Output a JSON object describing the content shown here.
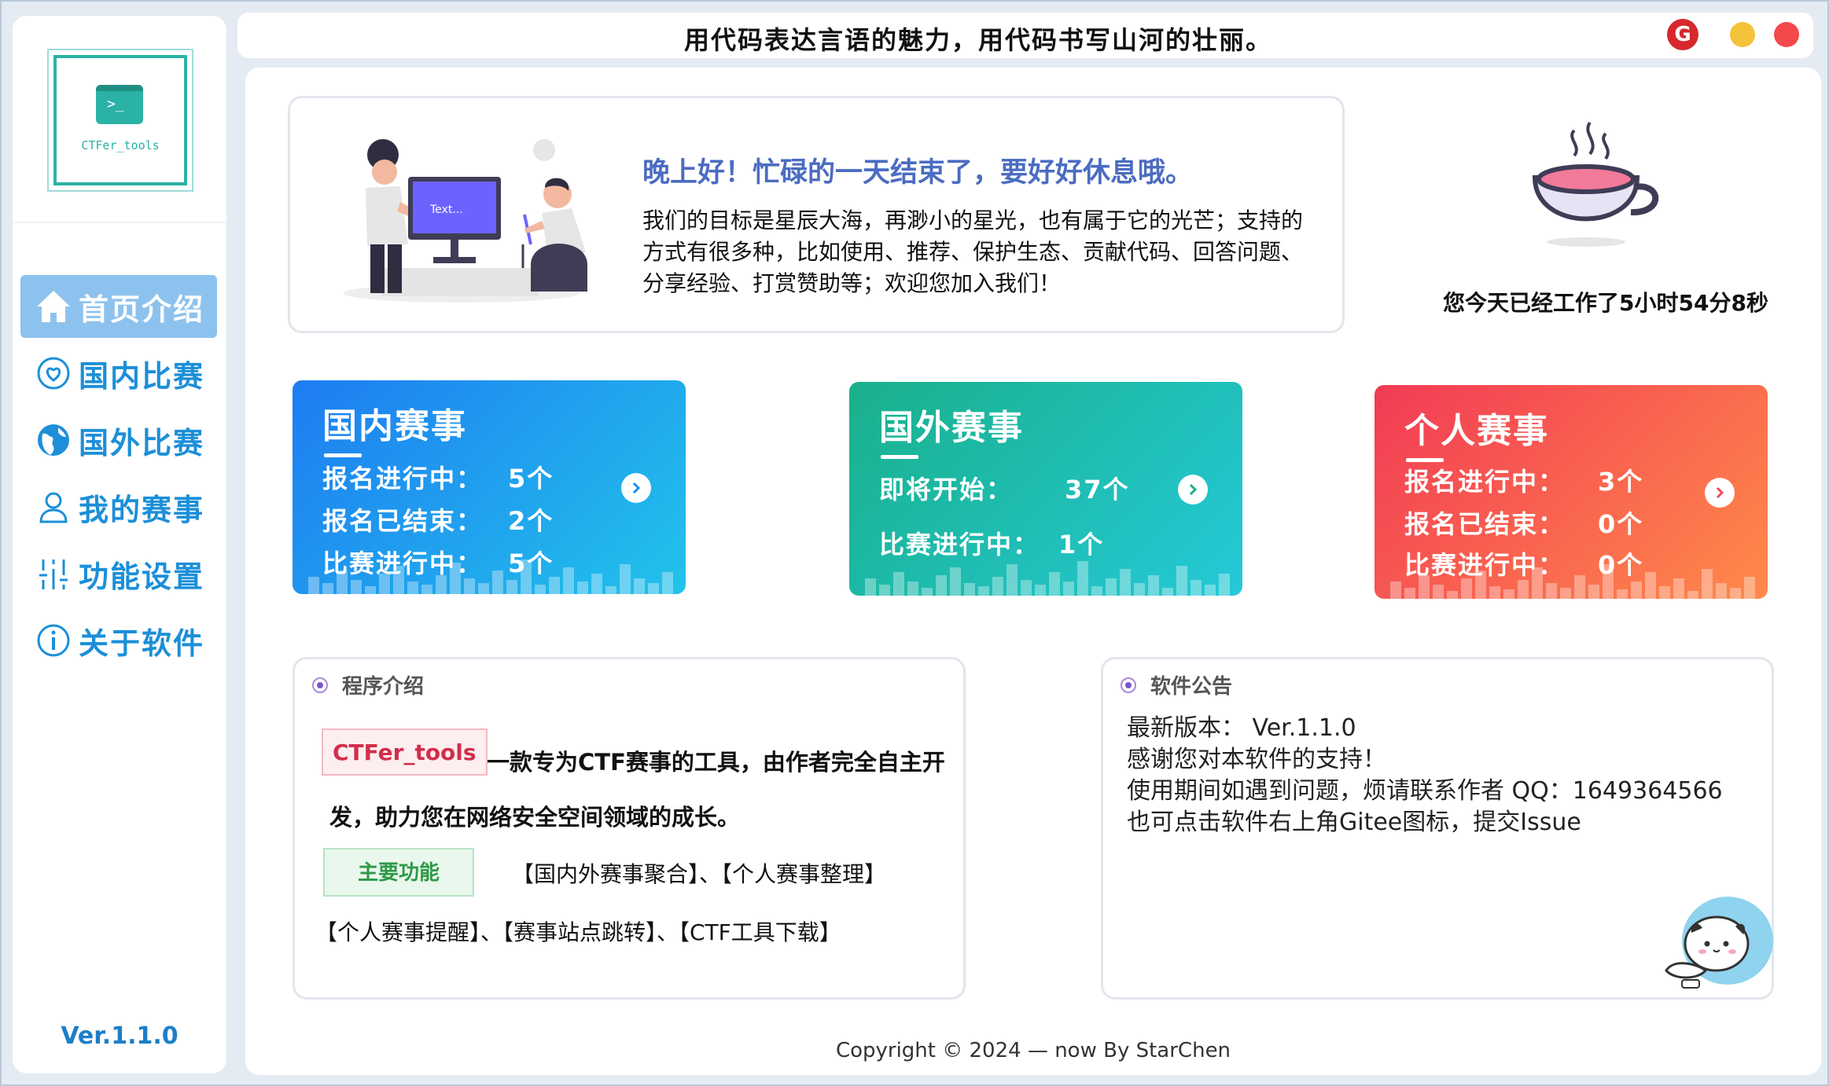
{
  "app": {
    "logo_text": "CTFer_tools",
    "version": "Ver.1.1.0"
  },
  "titlebar": {
    "slogan": "用代码表达言语的魅力，用代码书写山河的壮丽。",
    "gitee_icon": "G"
  },
  "sidebar": {
    "items": [
      {
        "label": "首页介绍",
        "icon": "home-icon",
        "active": true
      },
      {
        "label": "国内比赛",
        "icon": "heart-circle-icon",
        "active": false
      },
      {
        "label": "国外比赛",
        "icon": "globe-icon",
        "active": false
      },
      {
        "label": "我的赛事",
        "icon": "user-icon",
        "active": false
      },
      {
        "label": "功能设置",
        "icon": "sliders-icon",
        "active": false
      },
      {
        "label": "关于软件",
        "icon": "info-icon",
        "active": false
      }
    ]
  },
  "greeting": {
    "title": "晚上好！忙碌的一天结束了，要好好休息哦。",
    "body": "我们的目标是星辰大海，再渺小的星光，也有属于它的光芒；支持的方式有很多种，比如使用、推荐、保护生态、贡献代码、回答问题、分享经验、打赏赞助等；欢迎您加入我们！",
    "screen_text": "Text...",
    "worktime": "您今天已经工作了5小时54分8秒"
  },
  "stats": {
    "domestic": {
      "title": "国内赛事",
      "rows": [
        {
          "label": "报名进行中：",
          "value": "5个"
        },
        {
          "label": "报名已结束：",
          "value": "2个"
        },
        {
          "label": "比赛进行中：",
          "value": "5个"
        }
      ]
    },
    "foreign": {
      "title": "国外赛事",
      "rows": [
        {
          "label": "即将开始：",
          "value": "37个"
        },
        {
          "label": "比赛进行中：",
          "value": "1个"
        }
      ]
    },
    "personal": {
      "title": "个人赛事",
      "rows": [
        {
          "label": "报名进行中：",
          "value": "3个"
        },
        {
          "label": "报名已结束：",
          "value": "0个"
        },
        {
          "label": "比赛进行中：",
          "value": "0个"
        }
      ]
    }
  },
  "intro": {
    "heading": "程序介绍",
    "app_tag": "CTFer_tools",
    "text": "一款专为CTF赛事的工具，由作者完全自主开发，助力您在网络安全空间领域的成长。",
    "features_tag": "主要功能",
    "features_line1": "【国内外赛事聚合】、【个人赛事整理】",
    "features_line2": "【个人赛事提醒】、【赛事站点跳转】、【CTF工具下载】"
  },
  "notice": {
    "heading": "软件公告",
    "lines": [
      "最新版本： Ver.1.1.0",
      "感谢您对本软件的支持！",
      "使用期间如遇到问题，烦请联系作者 QQ：1649364566",
      "也可点击软件右上角Gitee图标，提交Issue"
    ]
  },
  "footer": {
    "copyright": "Copyright  ©  2024 — now  By StarChen"
  },
  "colors": {
    "accent": "#1c8fd8",
    "domestic_gradient": [
      "#1e7cf2",
      "#22c3ea"
    ],
    "foreign_gradient": [
      "#19b08a",
      "#25c9d8"
    ],
    "personal_gradient": [
      "#f23b55",
      "#ff8a4a"
    ]
  }
}
